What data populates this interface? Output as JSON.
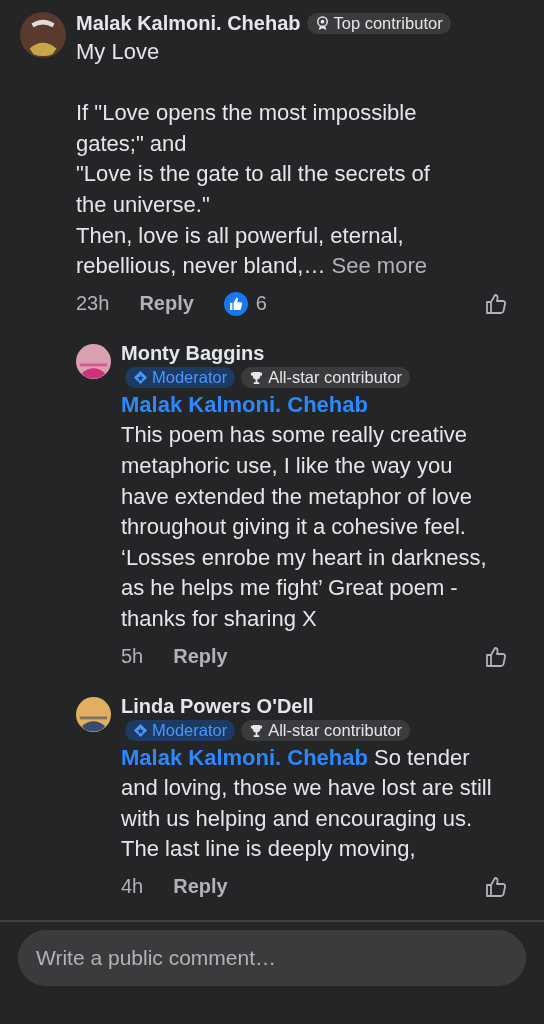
{
  "comments": [
    {
      "author": "Malak Kalmoni. Chehab",
      "badges": [
        {
          "kind": "top",
          "label": "Top contributor"
        }
      ],
      "text": "My Love\n\nIf \"Love opens the most impossible gates;\" and\n\"Love is the gate to all the secrets of the universe.\"\nThen, love is all powerful, eternal, rebellious, never bland,…",
      "see_more": "See more",
      "time": "23h",
      "reply": "Reply",
      "reactions": "6",
      "liked": false,
      "replies": [
        {
          "author": "Monty Baggins",
          "badges": [
            {
              "kind": "moderator",
              "label": "Moderator"
            },
            {
              "kind": "allstar",
              "label": "All-star contributor"
            }
          ],
          "mention": "Malak Kalmoni. Chehab",
          "text": "\nThis poem has some really creative metaphoric use, I like the way you have extended  the metaphor of love throughout giving it a cohesive feel. ‘Losses enrobe my heart in darkness, as he helps me fight’ Great poem - thanks for sharing X",
          "time": "5h",
          "reply": "Reply",
          "liked": false
        },
        {
          "author": "Linda Powers O'Dell",
          "badges": [
            {
              "kind": "moderator",
              "label": "Moderator"
            },
            {
              "kind": "allstar",
              "label": "All-star contributor"
            }
          ],
          "mention": "Malak Kalmoni. Chehab",
          "text": " So tender and loving, those we have lost are still with us helping and encouraging us. The last line is deeply moving,",
          "time": "4h",
          "reply": "Reply",
          "liked": false
        }
      ]
    }
  ],
  "composer": {
    "placeholder": "Write a public comment…"
  }
}
